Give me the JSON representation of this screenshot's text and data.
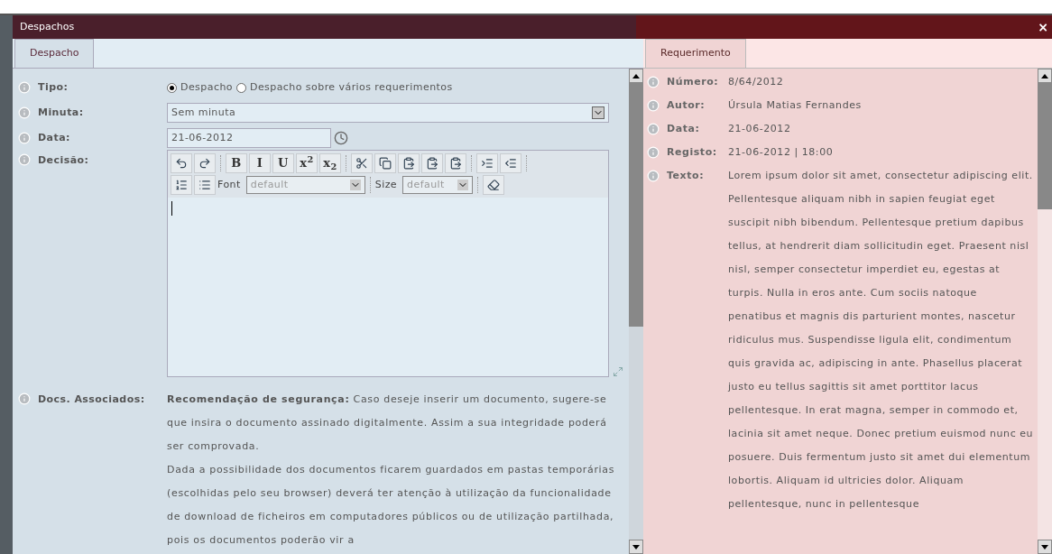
{
  "window": {
    "title": "Despachos",
    "close": "×"
  },
  "left": {
    "tabs": [
      {
        "label": "Despacho",
        "selected": true
      }
    ],
    "tipo": {
      "label": "Tipo:",
      "options": [
        {
          "label": "Despacho",
          "selected": true
        },
        {
          "label": "Despacho sobre vários requerimentos",
          "selected": false
        }
      ]
    },
    "minuta": {
      "label": "Minuta:",
      "value": "Sem minuta"
    },
    "data": {
      "label": "Data:",
      "value": "21-06-2012"
    },
    "decisao": {
      "label": "Decisão:",
      "toolbar_row_1": [
        {
          "kind": "undo"
        },
        {
          "kind": "redo"
        },
        {
          "kind": "sep"
        },
        {
          "kind": "text",
          "label": "B"
        },
        {
          "kind": "text",
          "label": "I"
        },
        {
          "kind": "text",
          "label": "U"
        },
        {
          "kind": "text",
          "label": "x$^{2}$"
        },
        {
          "kind": "text",
          "label": "x$_{2}$"
        },
        {
          "kind": "sep"
        },
        {
          "kind": "cut"
        },
        {
          "kind": "copy"
        },
        {
          "kind": "paste"
        },
        {
          "kind": "paste"
        },
        {
          "kind": "paste"
        },
        {
          "kind": "sep"
        },
        {
          "kind": "indent"
        },
        {
          "kind": "outdent"
        },
        {
          "kind": "sep"
        }
      ],
      "toolbar_row_2": [
        {
          "kind": "ordered-list"
        },
        {
          "kind": "bullet-list"
        },
        {
          "kind": "font",
          "label": "Font",
          "value": "default"
        },
        {
          "kind": "sep"
        },
        {
          "kind": "size",
          "label": "Size",
          "value": "default"
        },
        {
          "kind": "sep"
        },
        {
          "kind": "eraser"
        }
      ]
    },
    "docs": {
      "label": "Docs. Associados:",
      "paragraphs": [
        "**Recomendação de segurança:** Caso deseje inserir um documento, sugere-se que insira o documento assinado digitalmente. Assim a sua integridade poderá ser comprovada.",
        "Dada a possibilidade dos documentos ficarem guardados em pastas temporárias (escolhidas pelo seu browser) deverá ter atenção à utilização da funcionalidade de download de ficheiros em computadores públicos ou de utilização partilhada, pois os documentos poderão vir a"
      ]
    }
  },
  "right": {
    "tabs": [
      {
        "label": "Requerimento",
        "selected": true
      }
    ],
    "fields": [
      {
        "label": "Número:",
        "value": "8/64/2012"
      },
      {
        "label": "Autor:",
        "value": "Úrsula Matias Fernandes"
      },
      {
        "label": "Data:",
        "value": "21-06-2012"
      },
      {
        "label": "Registo:",
        "value": "21-06-2012 | 18:00"
      },
      {
        "label": "Texto:",
        "value": "Lorem ipsum dolor sit amet, consectetur adipiscing elit. Pellentesque aliquam nibh in sapien feugiat eget suscipit nibh bibendum. Pellentesque pretium dapibus tellus, at hendrerit diam sollicitudin eget. Praesent nisl nisl, semper consectetur imperdiet eu, egestas at turpis. Nulla in eros ante. Cum sociis natoque penatibus et magnis dis parturient montes, nascetur ridiculus mus. Suspendisse ligula elit, condimentum quis gravida ac, adipiscing in ante. Phasellus placerat justo eu tellus sagittis sit amet porttitor lacus pellentesque. In erat magna, semper in commodo et, lacinia sit amet neque. Donec pretium euismod nunc eu posuere. Duis fermentum justo sit amet dui elementum lobortis. Aliquam id ultricies dolor. Aliquam pellentesque, nunc in pellentesque"
      }
    ]
  }
}
